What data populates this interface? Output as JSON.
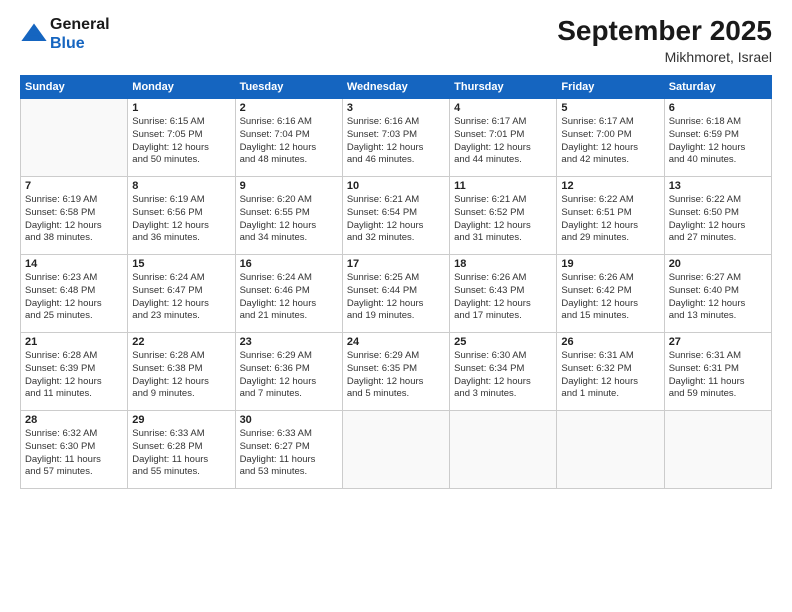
{
  "header": {
    "logo_line1": "General",
    "logo_line2": "Blue",
    "month": "September 2025",
    "location": "Mikhmoret, Israel"
  },
  "weekdays": [
    "Sunday",
    "Monday",
    "Tuesday",
    "Wednesday",
    "Thursday",
    "Friday",
    "Saturday"
  ],
  "weeks": [
    [
      {
        "day": "",
        "info": ""
      },
      {
        "day": "1",
        "info": "Sunrise: 6:15 AM\nSunset: 7:05 PM\nDaylight: 12 hours\nand 50 minutes."
      },
      {
        "day": "2",
        "info": "Sunrise: 6:16 AM\nSunset: 7:04 PM\nDaylight: 12 hours\nand 48 minutes."
      },
      {
        "day": "3",
        "info": "Sunrise: 6:16 AM\nSunset: 7:03 PM\nDaylight: 12 hours\nand 46 minutes."
      },
      {
        "day": "4",
        "info": "Sunrise: 6:17 AM\nSunset: 7:01 PM\nDaylight: 12 hours\nand 44 minutes."
      },
      {
        "day": "5",
        "info": "Sunrise: 6:17 AM\nSunset: 7:00 PM\nDaylight: 12 hours\nand 42 minutes."
      },
      {
        "day": "6",
        "info": "Sunrise: 6:18 AM\nSunset: 6:59 PM\nDaylight: 12 hours\nand 40 minutes."
      }
    ],
    [
      {
        "day": "7",
        "info": "Sunrise: 6:19 AM\nSunset: 6:58 PM\nDaylight: 12 hours\nand 38 minutes."
      },
      {
        "day": "8",
        "info": "Sunrise: 6:19 AM\nSunset: 6:56 PM\nDaylight: 12 hours\nand 36 minutes."
      },
      {
        "day": "9",
        "info": "Sunrise: 6:20 AM\nSunset: 6:55 PM\nDaylight: 12 hours\nand 34 minutes."
      },
      {
        "day": "10",
        "info": "Sunrise: 6:21 AM\nSunset: 6:54 PM\nDaylight: 12 hours\nand 32 minutes."
      },
      {
        "day": "11",
        "info": "Sunrise: 6:21 AM\nSunset: 6:52 PM\nDaylight: 12 hours\nand 31 minutes."
      },
      {
        "day": "12",
        "info": "Sunrise: 6:22 AM\nSunset: 6:51 PM\nDaylight: 12 hours\nand 29 minutes."
      },
      {
        "day": "13",
        "info": "Sunrise: 6:22 AM\nSunset: 6:50 PM\nDaylight: 12 hours\nand 27 minutes."
      }
    ],
    [
      {
        "day": "14",
        "info": "Sunrise: 6:23 AM\nSunset: 6:48 PM\nDaylight: 12 hours\nand 25 minutes."
      },
      {
        "day": "15",
        "info": "Sunrise: 6:24 AM\nSunset: 6:47 PM\nDaylight: 12 hours\nand 23 minutes."
      },
      {
        "day": "16",
        "info": "Sunrise: 6:24 AM\nSunset: 6:46 PM\nDaylight: 12 hours\nand 21 minutes."
      },
      {
        "day": "17",
        "info": "Sunrise: 6:25 AM\nSunset: 6:44 PM\nDaylight: 12 hours\nand 19 minutes."
      },
      {
        "day": "18",
        "info": "Sunrise: 6:26 AM\nSunset: 6:43 PM\nDaylight: 12 hours\nand 17 minutes."
      },
      {
        "day": "19",
        "info": "Sunrise: 6:26 AM\nSunset: 6:42 PM\nDaylight: 12 hours\nand 15 minutes."
      },
      {
        "day": "20",
        "info": "Sunrise: 6:27 AM\nSunset: 6:40 PM\nDaylight: 12 hours\nand 13 minutes."
      }
    ],
    [
      {
        "day": "21",
        "info": "Sunrise: 6:28 AM\nSunset: 6:39 PM\nDaylight: 12 hours\nand 11 minutes."
      },
      {
        "day": "22",
        "info": "Sunrise: 6:28 AM\nSunset: 6:38 PM\nDaylight: 12 hours\nand 9 minutes."
      },
      {
        "day": "23",
        "info": "Sunrise: 6:29 AM\nSunset: 6:36 PM\nDaylight: 12 hours\nand 7 minutes."
      },
      {
        "day": "24",
        "info": "Sunrise: 6:29 AM\nSunset: 6:35 PM\nDaylight: 12 hours\nand 5 minutes."
      },
      {
        "day": "25",
        "info": "Sunrise: 6:30 AM\nSunset: 6:34 PM\nDaylight: 12 hours\nand 3 minutes."
      },
      {
        "day": "26",
        "info": "Sunrise: 6:31 AM\nSunset: 6:32 PM\nDaylight: 12 hours\nand 1 minute."
      },
      {
        "day": "27",
        "info": "Sunrise: 6:31 AM\nSunset: 6:31 PM\nDaylight: 11 hours\nand 59 minutes."
      }
    ],
    [
      {
        "day": "28",
        "info": "Sunrise: 6:32 AM\nSunset: 6:30 PM\nDaylight: 11 hours\nand 57 minutes."
      },
      {
        "day": "29",
        "info": "Sunrise: 6:33 AM\nSunset: 6:28 PM\nDaylight: 11 hours\nand 55 minutes."
      },
      {
        "day": "30",
        "info": "Sunrise: 6:33 AM\nSunset: 6:27 PM\nDaylight: 11 hours\nand 53 minutes."
      },
      {
        "day": "",
        "info": ""
      },
      {
        "day": "",
        "info": ""
      },
      {
        "day": "",
        "info": ""
      },
      {
        "day": "",
        "info": ""
      }
    ]
  ]
}
